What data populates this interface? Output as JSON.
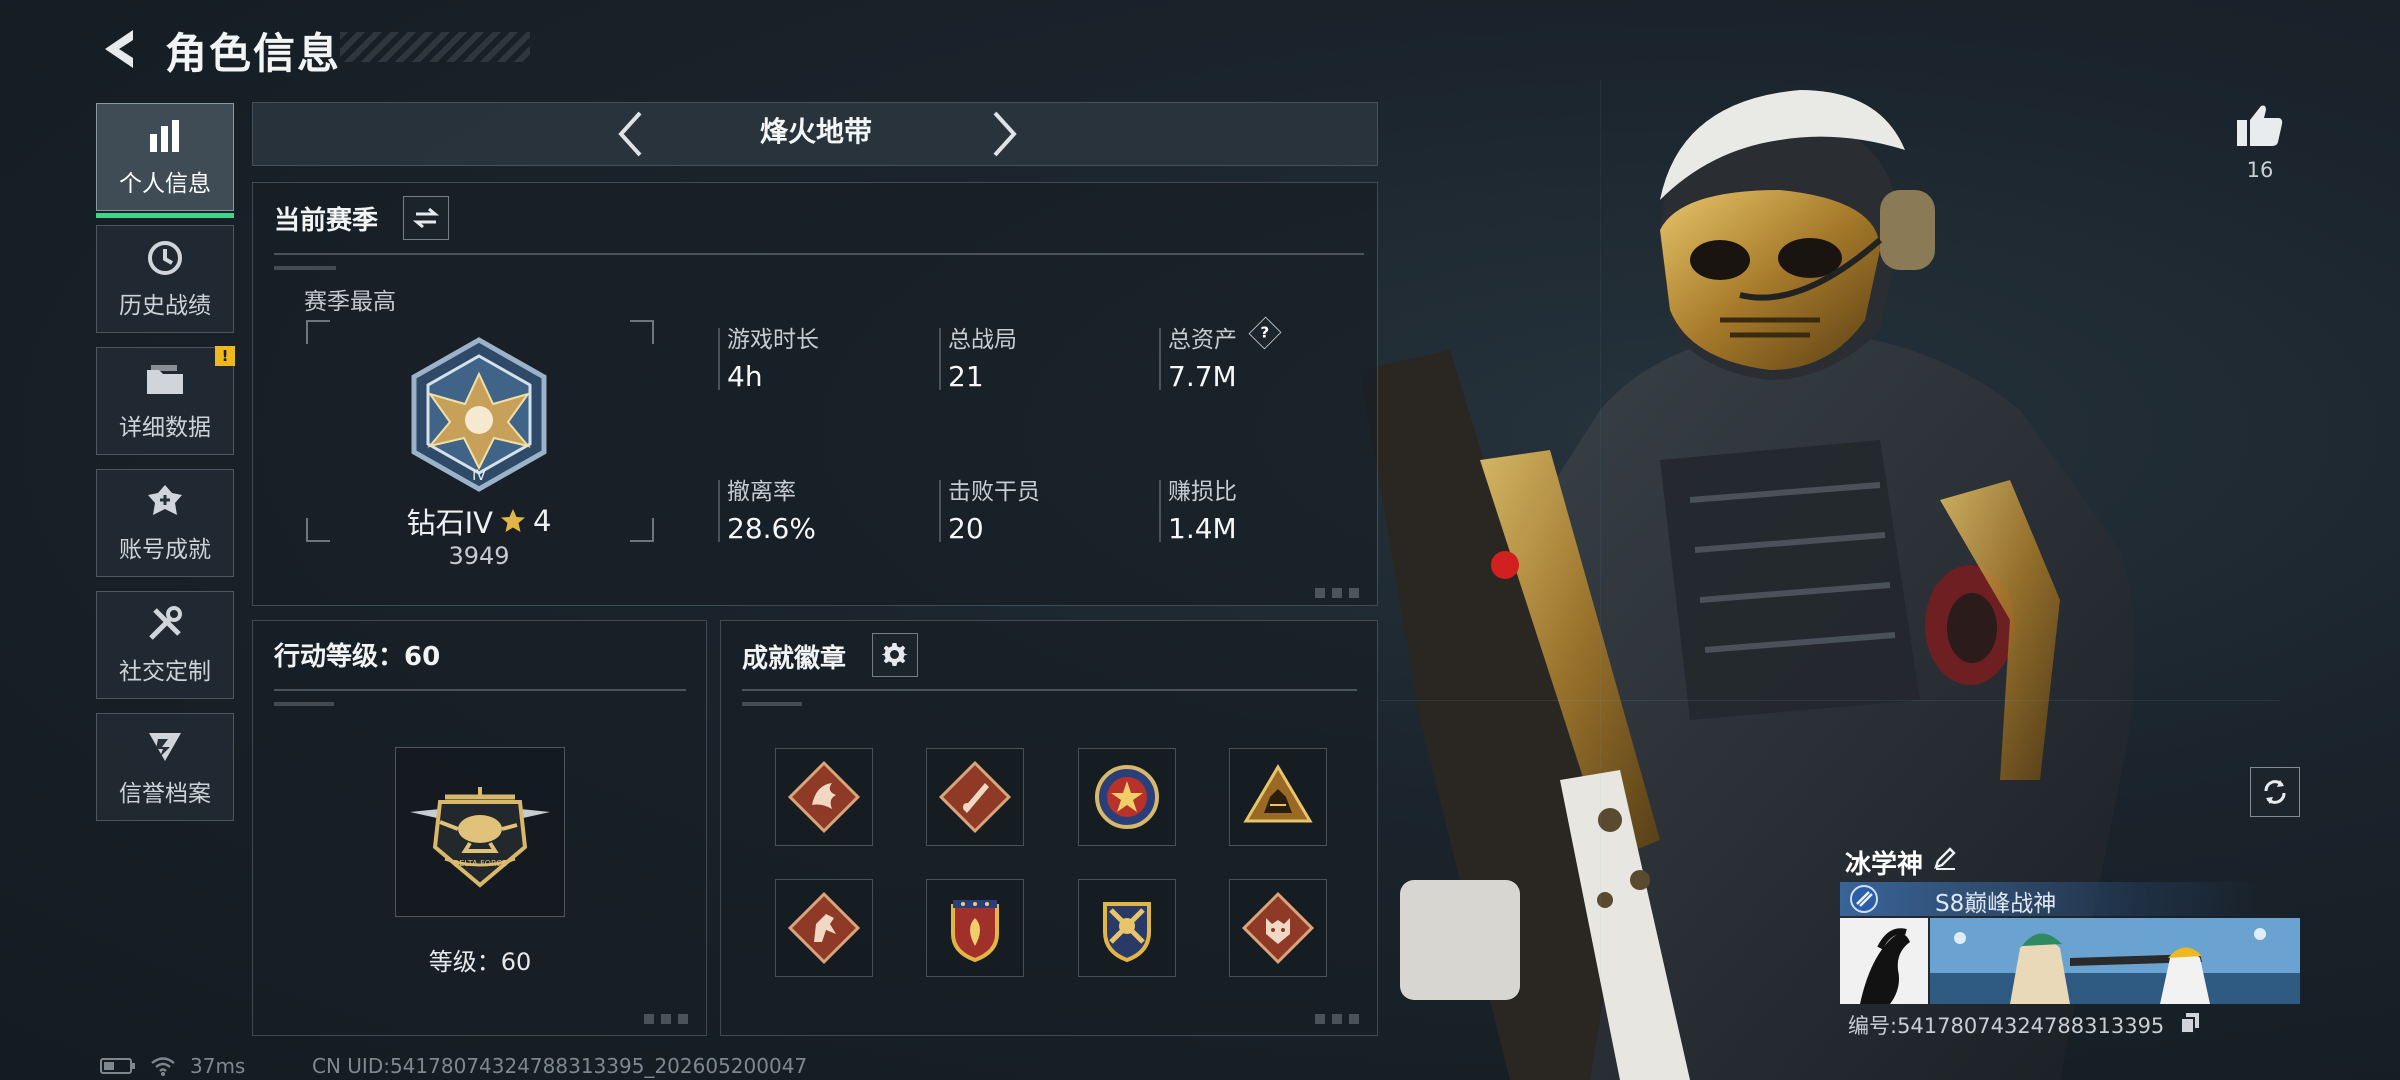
{
  "header": {
    "title": "角色信息"
  },
  "sidebar": {
    "items": [
      {
        "label": "个人信息",
        "icon": "bar-chart-icon",
        "active": true
      },
      {
        "label": "历史战绩",
        "icon": "history-clock-icon",
        "active": false
      },
      {
        "label": "详细数据",
        "icon": "folder-icon",
        "active": false,
        "badge": "!"
      },
      {
        "label": "账号成就",
        "icon": "achievement-icon",
        "active": false
      },
      {
        "label": "社交定制",
        "icon": "tools-icon",
        "active": false
      },
      {
        "label": "信誉档案",
        "icon": "credit-shield-icon",
        "active": false
      }
    ]
  },
  "mode": {
    "name": "烽火地带"
  },
  "season": {
    "title": "当前赛季",
    "subtitle": "赛季最高",
    "rank_name": "钻石IV",
    "rank_stars": "4",
    "rank_score": "3949",
    "stats": [
      {
        "label": "游戏时长",
        "value": "4h"
      },
      {
        "label": "总战局",
        "value": "21"
      },
      {
        "label": "总资产",
        "value": "7.7M",
        "help": "?"
      },
      {
        "label": "撤离率",
        "value": "28.6%"
      },
      {
        "label": "击败干员",
        "value": "20"
      },
      {
        "label": "赚损比",
        "value": "1.4M"
      }
    ]
  },
  "action_level": {
    "title": "行动等级：60",
    "level_label": "等级：60",
    "emblem_text": "DELTA FORCE"
  },
  "achievements": {
    "title": "成就徽章",
    "badges": [
      {
        "name": "dragon-badge",
        "color": "#b04a32"
      },
      {
        "name": "blade-badge",
        "color": "#b04a32"
      },
      {
        "name": "star-shield-badge",
        "color": "#c23a2e"
      },
      {
        "name": "triangle-beast-badge",
        "color": "#b8862e"
      },
      {
        "name": "horse-badge",
        "color": "#b04a32"
      },
      {
        "name": "crest-badge",
        "color": "#c28a2e"
      },
      {
        "name": "crossed-guns-badge",
        "color": "#c2a033"
      },
      {
        "name": "wolf-badge",
        "color": "#b04a32"
      }
    ]
  },
  "profile": {
    "likes": "16",
    "name": "冰学神",
    "title": "S8巅峰战神",
    "id_text": "编号:541780743247883133​95"
  },
  "status": {
    "ping": "37ms",
    "uid": "CN UID:54178074324788313395_202605200047"
  },
  "colors": {
    "accent_green": "#3ed68a",
    "warning_yellow": "#f0b81f",
    "gold": "#c9a04a"
  }
}
